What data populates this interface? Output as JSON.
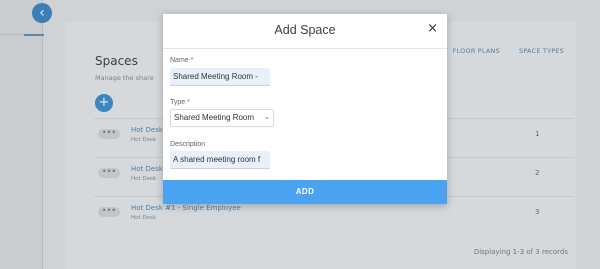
{
  "background": {
    "collapse_icon": "chevron-left-icon",
    "nav": {
      "floor_plans": "FLOOR PLANS",
      "space_types": "SPACE TYPES"
    },
    "section_title": "Spaces",
    "section_subtitle": "Manage the share",
    "add_icon": "+",
    "rows": [
      {
        "title": "Hot Desk",
        "subtitle": "Hot Desk",
        "count": "1"
      },
      {
        "title": "Hot Desk",
        "subtitle": "Hot Desk",
        "count": "2"
      },
      {
        "title": "Hot Desk #1 - Single Employee",
        "subtitle": "Hot Desk",
        "count": "3"
      }
    ],
    "row_actions_icon": "•••",
    "footer": "Displaying 1-3 of 3 records"
  },
  "modal": {
    "title": "Add Space",
    "close_icon": "×",
    "name": {
      "label": "Name",
      "required_mark": "*",
      "value": "Shared Meeting Room -"
    },
    "type": {
      "label": "Type",
      "required_mark": "*",
      "value": "Shared Meeting Room",
      "chevron": "⌄"
    },
    "description": {
      "label": "Description",
      "value": "A shared meeting room f"
    },
    "add_label": "ADD"
  }
}
